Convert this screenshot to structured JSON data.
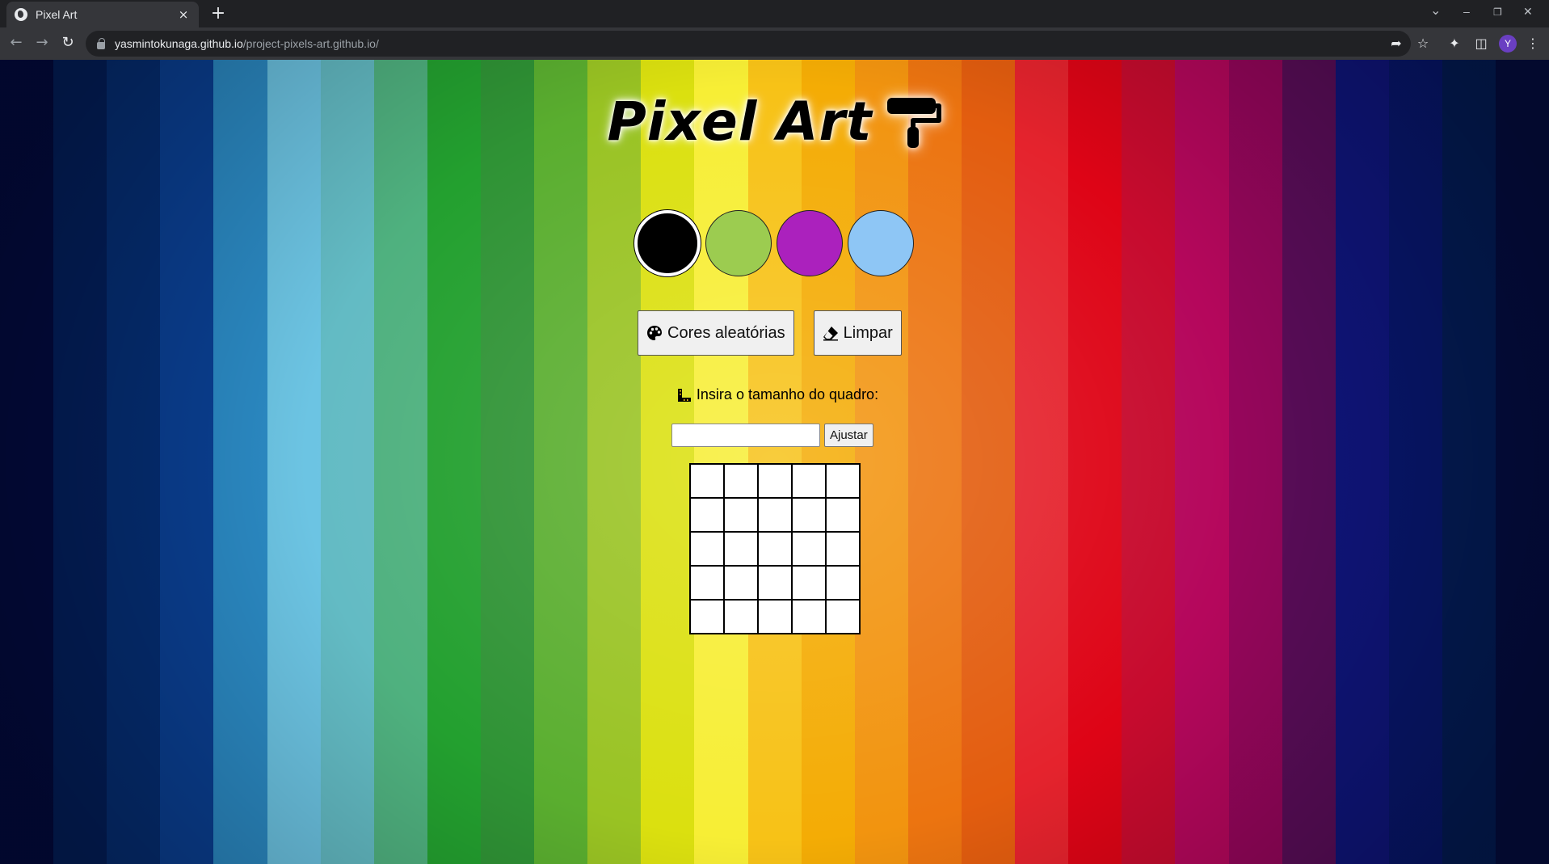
{
  "browser": {
    "tab_title": "Pixel Art",
    "tab_close": "×",
    "new_tab": "+",
    "url_host": "yasmintokunaga.github.io",
    "url_path": "/project-pixels-art.github.io/",
    "profile_initial": "Y",
    "window_controls": {
      "dropdown": "⌄",
      "minimize": "–",
      "restore": "❐",
      "close": "✕"
    }
  },
  "page": {
    "title": "Pixel Art",
    "palette": [
      {
        "name": "black",
        "color": "#000000",
        "selected": true
      },
      {
        "name": "green",
        "color": "#9ccc50",
        "selected": false
      },
      {
        "name": "purple",
        "color": "#ab21bd",
        "selected": false
      },
      {
        "name": "light-blue",
        "color": "#8ec6f5",
        "selected": false
      }
    ],
    "random_colors_label": "Cores aleatórias",
    "clear_label": "Limpar",
    "board_size_label": "Insira o tamanho do quadro:",
    "board_size_value": "",
    "adjust_label": "Ajustar",
    "board": {
      "rows": 5,
      "cols": 5,
      "cell_color": "#ffffff"
    }
  },
  "background_stripes": [
    "#020a3e",
    "#031e5a",
    "#052d72",
    "#0a3f92",
    "#2b8ac4",
    "#6cc4e3",
    "#63bbc4",
    "#4fb17f",
    "#23a02f",
    "#2f9335",
    "#5aae2f",
    "#99c323",
    "#dbe00f",
    "#f7ee35",
    "#f7c217",
    "#f4ac05",
    "#f2940f",
    "#ec7410",
    "#e35d0f",
    "#e5232d",
    "#de0416",
    "#c70b2e",
    "#b5075c",
    "#95065b",
    "#5a0d59",
    "#0f157c",
    "#07166c",
    "#031b55",
    "#040c40"
  ]
}
